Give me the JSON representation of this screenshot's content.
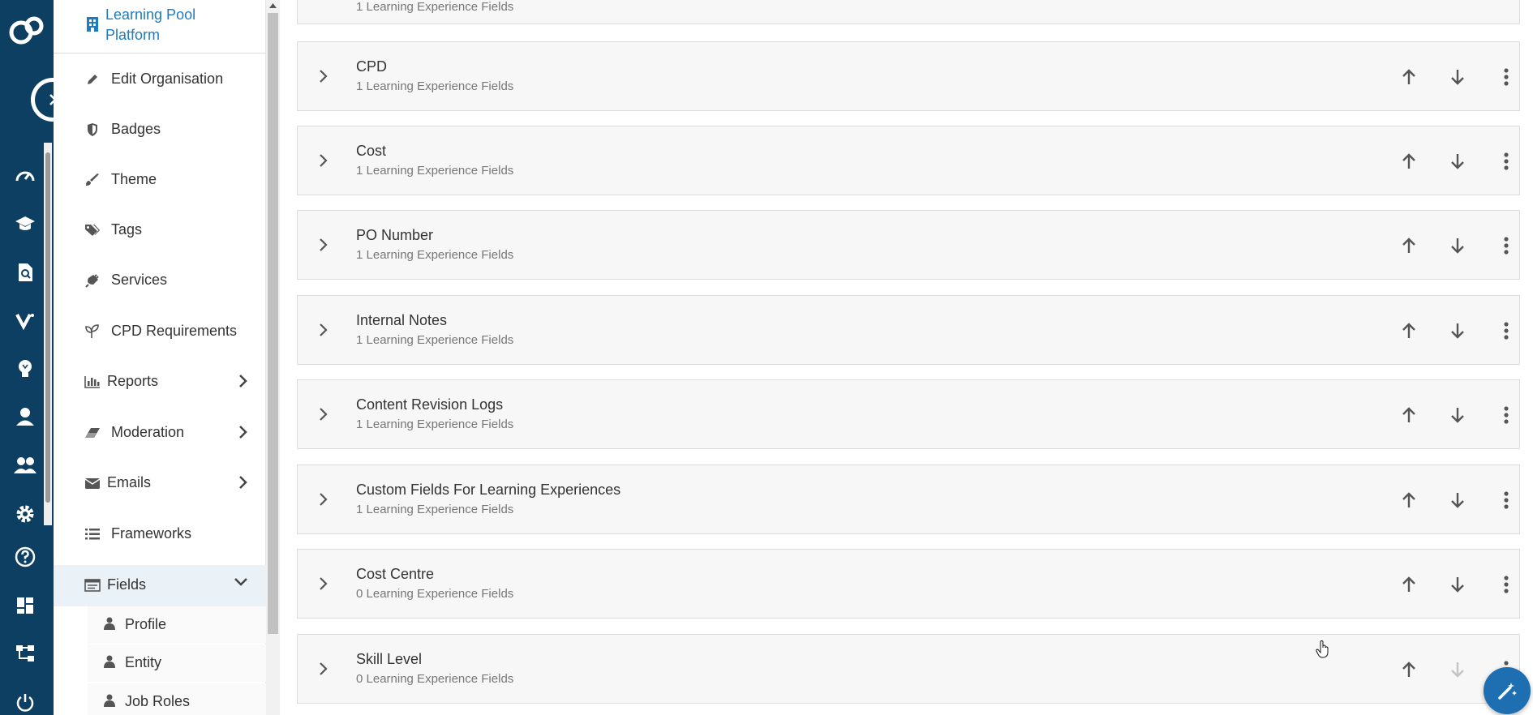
{
  "rail": {
    "icons": [
      "logo-icon",
      "sidebar-toggle-icon",
      "dashboard-icon",
      "learning-icon",
      "content-search-icon",
      "verb-icon",
      "ideas-icon",
      "user-icon",
      "groups-icon",
      "settings-icon",
      "help-icon",
      "layout-icon",
      "hierarchy-icon",
      "power-icon"
    ]
  },
  "sidebar": {
    "org_name": "Learning Pool Platform",
    "items": [
      {
        "label": "Edit Organisation",
        "icon": "pencil-icon"
      },
      {
        "label": "Badges",
        "icon": "shield-icon"
      },
      {
        "label": "Theme",
        "icon": "brush-icon"
      },
      {
        "label": "Tags",
        "icon": "tags-icon"
      },
      {
        "label": "Services",
        "icon": "plug-icon"
      },
      {
        "label": "CPD Requirements",
        "icon": "seedling-icon"
      },
      {
        "label": "Reports",
        "icon": "chart-icon"
      },
      {
        "label": "Moderation",
        "icon": "eraser-icon"
      },
      {
        "label": "Emails",
        "icon": "envelope-icon"
      },
      {
        "label": "Frameworks",
        "icon": "list-icon"
      },
      {
        "label": "Fields",
        "icon": "fields-icon"
      }
    ],
    "sub_items": [
      {
        "label": "Profile",
        "icon": "person-icon"
      },
      {
        "label": "Entity",
        "icon": "person-icon"
      },
      {
        "label": "Job Roles",
        "icon": "person-icon"
      }
    ]
  },
  "main": {
    "top_partial_subtitle": "1 Learning Experience Fields",
    "cards": [
      {
        "title": "CPD",
        "subtitle": "1 Learning Experience Fields"
      },
      {
        "title": "Cost",
        "subtitle": "1 Learning Experience Fields"
      },
      {
        "title": "PO Number",
        "subtitle": "1 Learning Experience Fields"
      },
      {
        "title": "Internal Notes",
        "subtitle": "1 Learning Experience Fields"
      },
      {
        "title": "Content Revision Logs",
        "subtitle": "1 Learning Experience Fields"
      },
      {
        "title": "Custom Fields For Learning Experiences",
        "subtitle": "1 Learning Experience Fields"
      },
      {
        "title": "Cost Centre",
        "subtitle": "0 Learning Experience Fields"
      },
      {
        "title": "Skill Level",
        "subtitle": "0 Learning Experience Fields"
      }
    ]
  },
  "colors": {
    "rail_bg": "#0d3f62",
    "accent": "#1f7bbf",
    "active_item_bg": "#eaf1f7",
    "fab": "#1e6eb2"
  }
}
